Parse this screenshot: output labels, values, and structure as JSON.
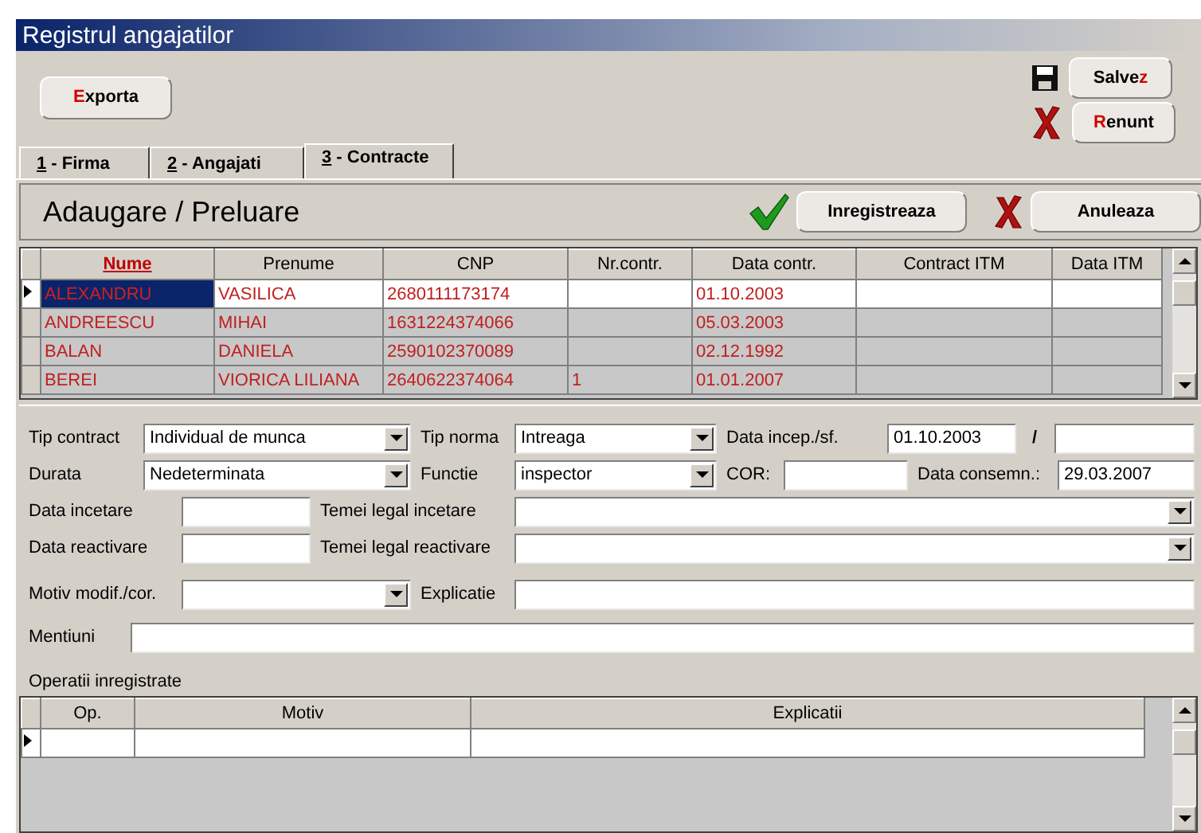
{
  "window": {
    "title": "Registrul angajatilor"
  },
  "toolbar": [
    {
      "kind": "export",
      "accent": "E",
      "after": "xporta"
    },
    {
      "kind": "save",
      "before": "Salve",
      "accent": "z"
    },
    {
      "kind": "cancel",
      "accent": "R",
      "after": "enunt"
    }
  ],
  "tabs": [
    {
      "accent": "1",
      "after": " - Firma",
      "selected": false
    },
    {
      "accent": "2",
      "after": " - Angajati",
      "selected": false
    },
    {
      "accent": "3",
      "after": " - Contracte",
      "selected": true
    }
  ],
  "section": {
    "title": "Adaugare / Preluare",
    "buttons": [
      {
        "kind": "confirm",
        "label": "Inregistreaza"
      },
      {
        "kind": "cancel",
        "label": "Anuleaza"
      }
    ]
  },
  "contracts": {
    "columns": [
      {
        "label": "Nume",
        "sorted": true
      },
      {
        "label": "Prenume",
        "sorted": false
      },
      {
        "label": "CNP",
        "sorted": false
      },
      {
        "label": "Nr.contr.",
        "sorted": false
      },
      {
        "label": "Data contr.",
        "sorted": false
      },
      {
        "label": "Contract ITM",
        "sorted": false
      },
      {
        "label": "Data ITM",
        "sorted": false
      }
    ],
    "rows": [
      {
        "selected": true,
        "cells": [
          "ALEXANDRU",
          "VASILICA",
          "2680111173174",
          null,
          "01.10.2003",
          null,
          null
        ]
      },
      {
        "selected": false,
        "cells": [
          "ANDREESCU",
          "MIHAI",
          "1631224374066",
          null,
          "05.03.2003",
          null,
          null
        ]
      },
      {
        "selected": false,
        "cells": [
          "BALAN",
          "DANIELA",
          "2590102370089",
          null,
          "02.12.1992",
          null,
          null
        ]
      },
      {
        "selected": false,
        "cells": [
          "BEREI",
          "VIORICA LILIANA",
          "2640622374064",
          "1",
          "01.01.2007",
          null,
          null
        ]
      }
    ]
  },
  "form": {
    "rows": [
      [
        {
          "label": "Tip contract",
          "kind": "select",
          "value": "Individual de munca"
        },
        {
          "label": "Tip norma",
          "kind": "select",
          "value": "Intreaga"
        },
        {
          "label": "Data incep./sf.",
          "kind": "text",
          "value": "01.10.2003"
        },
        {
          "label": "/",
          "kind": "text"
        }
      ],
      [
        {
          "label": "Durata",
          "kind": "select",
          "value": "Nedeterminata"
        },
        {
          "label": "Functie",
          "kind": "select",
          "value": "inspector"
        },
        {
          "label": "COR:",
          "kind": "text"
        },
        {
          "label": "Data consemn.:",
          "kind": "text",
          "value": "29.03.2007"
        }
      ],
      [
        {
          "label": "Data incetare",
          "kind": "text"
        },
        {
          "label": "Temei legal incetare",
          "kind": "select"
        }
      ],
      [
        {
          "label": "Data reactivare",
          "kind": "text"
        },
        {
          "label": "Temei legal reactivare",
          "kind": "select"
        }
      ],
      [
        {
          "label": "Motiv modif./cor.",
          "kind": "select"
        },
        {
          "label": "Explicatie",
          "kind": "text"
        }
      ],
      [
        {
          "label": "Mentiuni",
          "kind": "text"
        }
      ]
    ]
  },
  "operations": {
    "label": "Operatii inregistrate",
    "columns": [
      "Op.",
      "Motiv",
      "Explicatii"
    ],
    "rows": [
      {
        "selected": true
      }
    ]
  }
}
